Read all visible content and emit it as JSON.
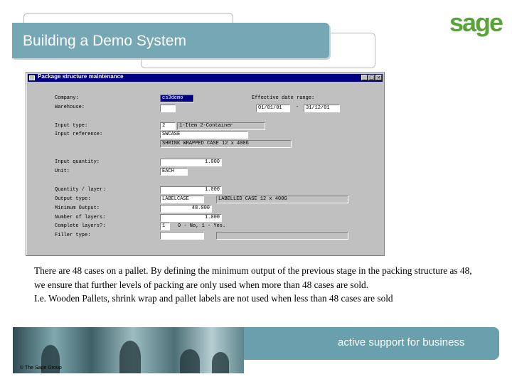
{
  "slide": {
    "title": "Building a Demo System",
    "logo": "sage",
    "slogan": "active support for business",
    "copyright": "© The Sage Group",
    "accent": "#76a7b4",
    "logo_color": "#5aa33a"
  },
  "window": {
    "title": "Package structure maintenance",
    "buttons": {
      "minimize": "_",
      "maximize": "□",
      "close": "×"
    }
  },
  "form": {
    "company_label": "Company:",
    "company_value": "cs3demo",
    "effective_date_label": "Effective date range:",
    "date_from": "01/01/01",
    "date_separator": "-",
    "date_to": "31/12/01",
    "warehouse_label": "Warehouse:",
    "warehouse_value": "",
    "input_type_label": "Input type:",
    "input_type_value": "2",
    "input_type_desc": "1-Item 2-Container",
    "input_reference_label": "Input reference:",
    "input_reference_value": "SWCASE",
    "input_reference_desc": "SHRINK WRAPPED CASE 12 x 400G",
    "input_quantity_label": "Input quantity:",
    "input_quantity_value": "1.000",
    "unit_label": "Unit:",
    "unit_value": "EACH",
    "quantity_layer_label": "Quantity / layer:",
    "quantity_layer_value": "1.000",
    "output_type_label": "Output type:",
    "output_type_value": "LABELCASE",
    "output_type_desc": "LABELLED CASE 12 x 400G",
    "minimum_output_label": "Minimum Output:",
    "minimum_output_value": "48.000",
    "number_layers_label": "Number of layers:",
    "number_layers_value": "1.000",
    "complete_layers_label": "Complete layers?:",
    "complete_layers_value": "1",
    "complete_layers_hint": "0 - No, 1 - Yes.",
    "filler_type_label": "Filler type:",
    "filler_type_value": "",
    "filler_type_desc": ""
  },
  "description": {
    "paragraph1": "There are 48 cases on a pallet. By defining the minimum output of the previous stage in the packing structure as 48,  we ensure that further levels of packing are only used when more than 48 cases are sold.",
    "paragraph2": "I.e. Wooden Pallets, shrink wrap and pallet labels are not used when less than 48 cases are sold"
  }
}
